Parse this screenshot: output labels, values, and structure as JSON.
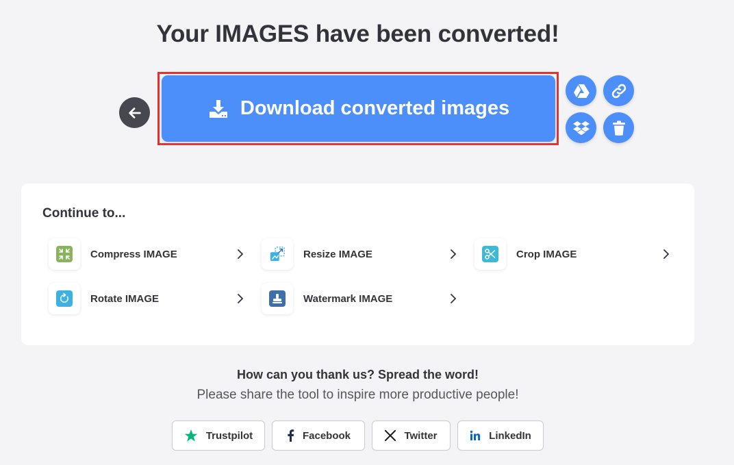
{
  "headline": "Your IMAGES have been converted!",
  "download": {
    "label": "Download converted images"
  },
  "continue": {
    "title": "Continue to...",
    "tools": [
      {
        "label": "Compress IMAGE",
        "icon": "compress-icon",
        "color": "#8ab25f"
      },
      {
        "label": "Resize IMAGE",
        "icon": "resize-icon",
        "color": "#3fb1e0"
      },
      {
        "label": "Crop IMAGE",
        "icon": "crop-icon",
        "color": "#3fb8d6"
      },
      {
        "label": "Rotate IMAGE",
        "icon": "rotate-icon",
        "color": "#3fb1e0"
      },
      {
        "label": "Watermark IMAGE",
        "icon": "watermark-icon",
        "color": "#3f6fa8"
      }
    ]
  },
  "share": {
    "title": "How can you thank us? Spread the word!",
    "subtitle": "Please share the tool to inspire more productive people!",
    "buttons": [
      {
        "label": "Trustpilot",
        "icon": "trustpilot-star-icon",
        "color": "#00b67a"
      },
      {
        "label": "Facebook",
        "icon": "facebook-icon",
        "color": "#1c2e4a"
      },
      {
        "label": "Twitter",
        "icon": "x-twitter-icon",
        "color": "#1c1c1c"
      },
      {
        "label": "LinkedIn",
        "icon": "linkedin-icon",
        "color": "#0a66c2"
      }
    ]
  },
  "colors": {
    "accent": "#4d8ffa",
    "highlight": "#e5322d",
    "back": "#47474f",
    "background": "#f4f4f6"
  }
}
